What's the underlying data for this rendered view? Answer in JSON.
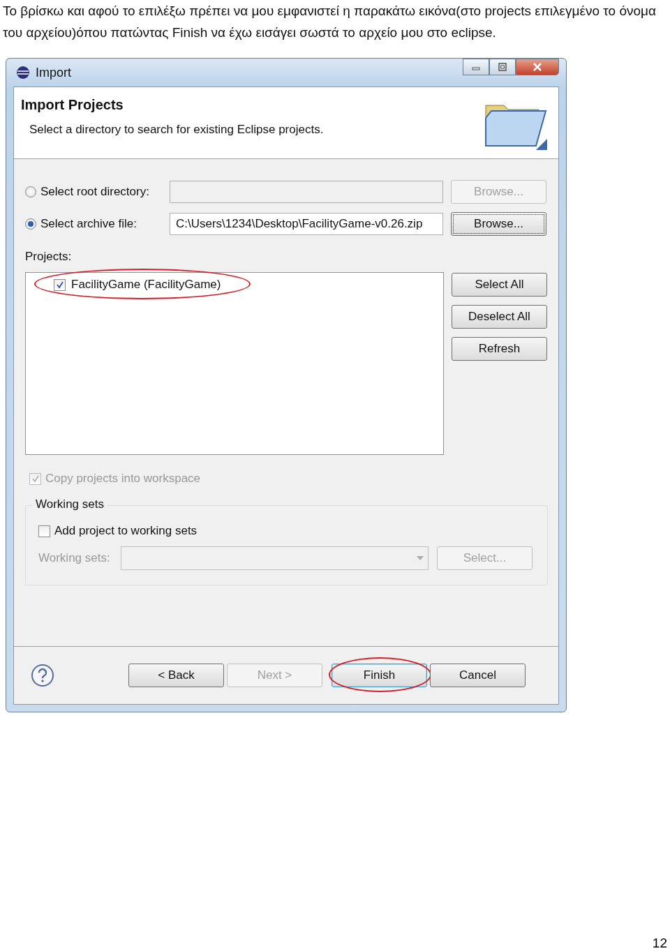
{
  "doc_text": "Το βρίσκω και αφού το επιλέξω πρέπει να μου εμφανιστεί η παρακάτω εικόνα(στο projects επιλεγμένο το όνομα του αρχείου)όπου πατώντας Finish να έχω εισάγει σωστά το αρχείο μου στο eclipse.",
  "window": {
    "title": "Import",
    "header": {
      "title": "Import Projects",
      "description": "Select a directory to search for existing Eclipse projects."
    },
    "sources": [
      {
        "label": "Select root directory:",
        "selected": false,
        "browse": {
          "label": "Browse...",
          "disabled": true,
          "focused": false
        }
      },
      {
        "label": "Select archive file:",
        "selected": true,
        "value": "C:\\Users\\1234\\Desktop\\FacilityGame-v0.26.zip",
        "browse": {
          "label": "Browse...",
          "disabled": false,
          "focused": true
        }
      }
    ],
    "projects_label": "Projects:",
    "projects": [
      {
        "label": "FacilityGame (FacilityGame)",
        "checked": true,
        "circled": true
      }
    ],
    "side_buttons": [
      "Select All",
      "Deselect All",
      "Refresh"
    ],
    "copy_option": {
      "label": "Copy projects into workspace",
      "checked": true,
      "disabled": true
    },
    "working_sets": {
      "title": "Working sets",
      "add_option": {
        "label": "Add project to working sets",
        "checked": false,
        "disabled": false
      },
      "field_label": "Working sets:",
      "select_button": "Select..."
    },
    "buttons": [
      {
        "label": "< Back",
        "disabled": false,
        "circled": false
      },
      {
        "label": "Next >",
        "disabled": true,
        "circled": false
      },
      {
        "label": "Finish",
        "disabled": false,
        "circled": true
      },
      {
        "label": "Cancel",
        "disabled": false,
        "circled": false
      }
    ]
  },
  "page_number": "12"
}
